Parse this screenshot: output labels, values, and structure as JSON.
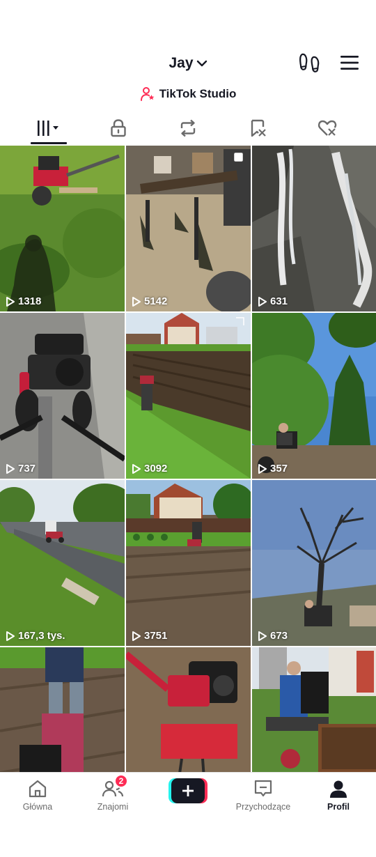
{
  "header": {
    "username": "Jay",
    "studio_label": "TikTok Studio"
  },
  "tabs": [
    {
      "name": "videos",
      "icon": "grid-bars-icon",
      "active": true
    },
    {
      "name": "private",
      "icon": "lock-icon"
    },
    {
      "name": "reposts",
      "icon": "repost-icon"
    },
    {
      "name": "favorites",
      "icon": "bookmark-icon"
    },
    {
      "name": "liked",
      "icon": "heart-icon"
    }
  ],
  "videos": [
    {
      "views": "1318",
      "scene": "grass-tiller"
    },
    {
      "views": "5142",
      "scene": "workshop-plow",
      "multi": true
    },
    {
      "views": "631",
      "scene": "waterfall"
    },
    {
      "views": "737",
      "scene": "road-tiller"
    },
    {
      "views": "3092",
      "scene": "field-rows"
    },
    {
      "views": "357",
      "scene": "trees-sky"
    },
    {
      "views": "167,3 tys.",
      "scene": "country-road"
    },
    {
      "views": "3751",
      "scene": "garden-house"
    },
    {
      "views": "673",
      "scene": "bare-tree"
    },
    {
      "views": "",
      "scene": "tilling-soil"
    },
    {
      "views": "",
      "scene": "red-tiller"
    },
    {
      "views": "",
      "scene": "tractor-trailer"
    }
  ],
  "nav": {
    "home": "Główna",
    "friends": "Znajomi",
    "friends_badge": "2",
    "inbox": "Przychodzące",
    "profile": "Profil"
  },
  "colors": {
    "accent_red": "#fe2c55",
    "accent_cyan": "#25f4ee",
    "text": "#161823"
  }
}
